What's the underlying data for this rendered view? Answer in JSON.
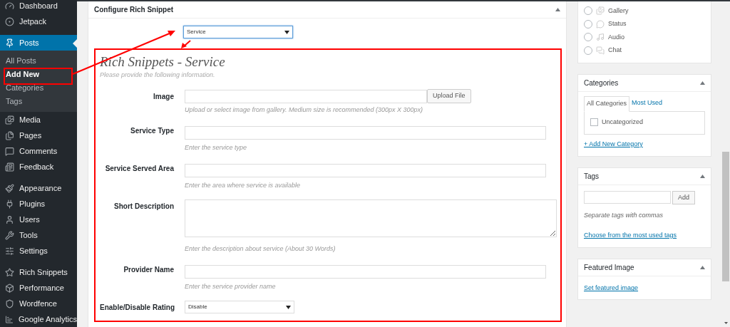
{
  "sidebar": {
    "groups": [
      [
        {
          "label": "Dashboard",
          "selected": false
        },
        {
          "label": "Jetpack",
          "selected": false
        }
      ],
      [
        {
          "label": "Posts",
          "selected": true,
          "children": [
            {
              "label": "All Posts",
              "selected": false
            },
            {
              "label": "Add New",
              "selected": true
            },
            {
              "label": "Categories",
              "selected": false
            },
            {
              "label": "Tags",
              "selected": false
            }
          ]
        },
        {
          "label": "Media",
          "selected": false
        },
        {
          "label": "Pages",
          "selected": false
        },
        {
          "label": "Comments",
          "selected": false
        },
        {
          "label": "Feedback",
          "selected": false
        }
      ],
      [
        {
          "label": "Appearance",
          "selected": false
        },
        {
          "label": "Plugins",
          "selected": false
        },
        {
          "label": "Users",
          "selected": false
        },
        {
          "label": "Tools",
          "selected": false
        },
        {
          "label": "Settings",
          "selected": false
        }
      ],
      [
        {
          "label": "Rich Snippets",
          "selected": false
        },
        {
          "label": "Performance",
          "selected": false
        },
        {
          "label": "Wordfence",
          "selected": false
        },
        {
          "label": "Google Analytics",
          "selected": false
        }
      ]
    ]
  },
  "main_box": {
    "title": "Configure Rich Snippet",
    "snippet_type": "Service",
    "section": {
      "title": "Rich Snippets - Service",
      "intro": "Please provide the following information.",
      "fields": [
        {
          "kind": "image",
          "label": "Image",
          "button": "Upload File",
          "hint": "Upload or select image from gallery. Medium size is recommended (300px X 300px)"
        },
        {
          "kind": "text",
          "label": "Service Type",
          "hint": "Enter the service type"
        },
        {
          "kind": "text",
          "label": "Service Served Area",
          "hint": "Enter the area where service is available"
        },
        {
          "kind": "textarea",
          "label": "Short Description",
          "hint": "Enter the description about service (About 30 Words)"
        },
        {
          "kind": "text",
          "label": "Provider Name",
          "hint": "Enter the service provider name"
        },
        {
          "kind": "select",
          "label": "Enable/Disable Rating",
          "value": "Disable"
        }
      ]
    }
  },
  "format_box": {
    "options": [
      {
        "label": "Gallery",
        "selected": false
      },
      {
        "label": "Status",
        "selected": false
      },
      {
        "label": "Audio",
        "selected": false
      },
      {
        "label": "Chat",
        "selected": false
      }
    ]
  },
  "categories": {
    "title": "Categories",
    "tabs": [
      {
        "label": "All Categories",
        "selected": true
      },
      {
        "label": "Most Used",
        "selected": false
      }
    ],
    "items": [
      {
        "label": "Uncategorized",
        "checked": false
      }
    ],
    "link": "+ Add New Category"
  },
  "tags": {
    "title": "Tags",
    "button": "Add",
    "hint": "Separate tags with commas",
    "link": "Choose from the most used tags"
  },
  "featured_image": {
    "title": "Featured Image",
    "link": "Set featured image"
  }
}
